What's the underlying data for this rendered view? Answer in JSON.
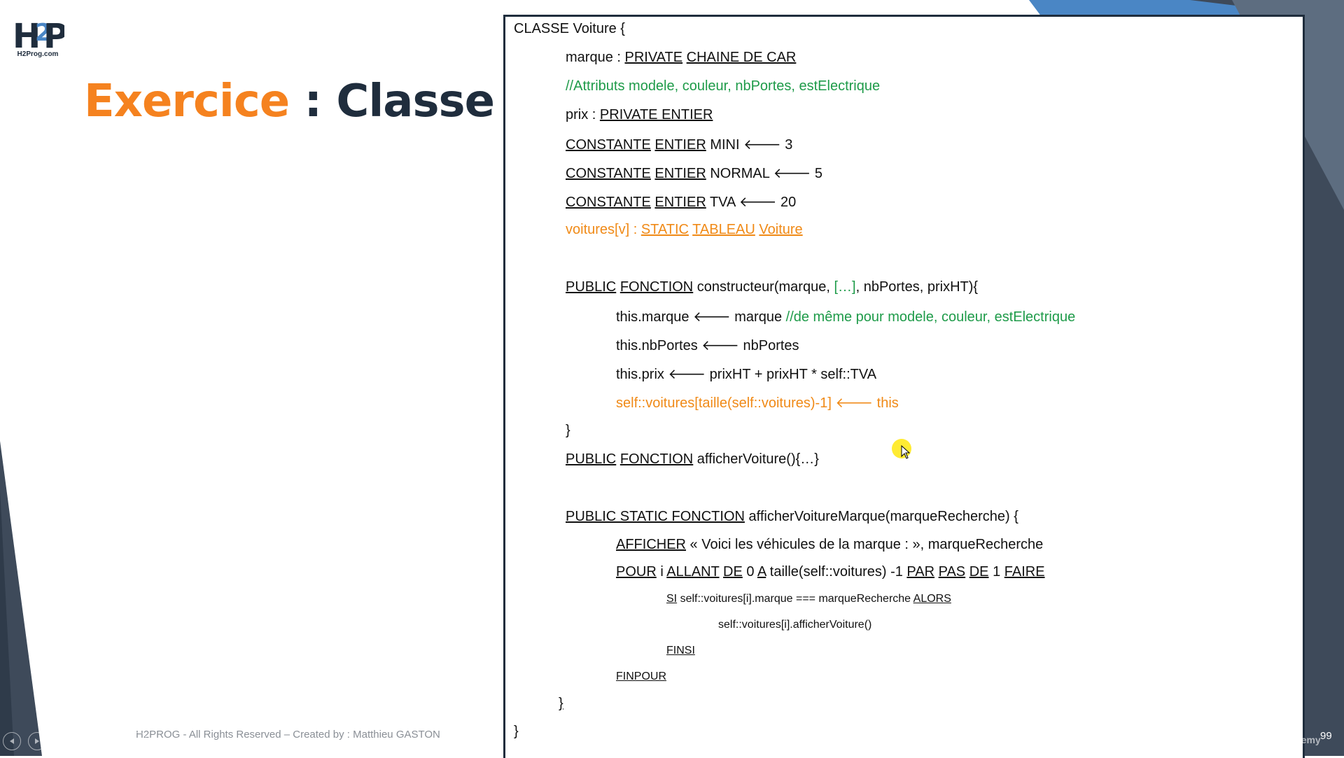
{
  "logo": {
    "caption": "H2Prog.com"
  },
  "slide": {
    "title_orange": "Exercice",
    "title_rest": " : Classe"
  },
  "code": {
    "l1": "CLASSE Voiture {",
    "l2_a": "marque : ",
    "l2_b": "PRIVATE",
    "l2_c": " ",
    "l2_d": "CHAINE DE CAR",
    "l3": "//Attributs modele, couleur, nbPortes, estElectrique",
    "l4_a": "prix : ",
    "l4_b": "PRIVATE ENTIER",
    "l5_a": "CONSTANTE",
    "l5_b": "ENTIER",
    "l5_c": " MINI ",
    "l5_d": " 3",
    "l6_a": "CONSTANTE",
    "l6_b": "ENTIER",
    "l6_c": " NORMAL ",
    "l6_d": " 5",
    "l7_a": "CONSTANTE",
    "l7_b": "ENTIER",
    "l7_c": " TVA ",
    "l7_d": " 20",
    "l8_a": "voitures[v] : ",
    "l8_b": "STATIC",
    "l8_c": "TABLEAU",
    "l8_d": "Voiture",
    "l9_a": "PUBLIC",
    "l9_b": "FONCTION",
    "l9_c": " constructeur(marque, ",
    "l9_d": "[…]",
    "l9_e": ", nbPortes, prixHT){",
    "l10_a": "this.marque ",
    "l10_b": " marque ",
    "l10_c": "//de même pour modele, couleur, estElectrique",
    "l11_a": "this.nbPortes ",
    "l11_b": " nbPortes",
    "l12_a": "this.prix ",
    "l12_b": " prixHT + prixHT * self::TVA",
    "l13_a": "self::voitures[taille(self::voitures)-1] ",
    "l13_b": " this",
    "l14": "}",
    "l15_a": "PUBLIC",
    "l15_b": "FONCTION",
    "l15_c": " afficherVoiture(){…}",
    "l16_a": "PUBLIC STATIC FONCTION",
    "l16_b": " afficherVoitureMarque(marqueRecherche) {",
    "l17_a": "AFFICHER",
    "l17_b": " « Voici les véhicules de la marque :  », marqueRecherche",
    "l18_a": "POUR",
    "l18_b": " i ",
    "l18_c": "ALLANT",
    "l18_d": " ",
    "l18_e": "DE",
    "l18_f": " 0 ",
    "l18_g": "A",
    "l18_h": " taille(self::voitures) -1 ",
    "l18_i": "PAR",
    "l18_j": " ",
    "l18_k": "PAS",
    "l18_l": " ",
    "l18_m": "DE",
    "l18_n": " 1 ",
    "l18_o": "FAIRE",
    "l19_a": "SI",
    "l19_b": " self::voitures[i].marque === marqueRecherche ",
    "l19_c": "ALORS",
    "l20": "self::voitures[i].afficherVoiture()",
    "l21": "FINSI",
    "l22": "FINPOUR",
    "l23": "}",
    "l24": "}"
  },
  "footer": {
    "text": "H2PROG - All Rights Reserved – Created by : Matthieu GASTON",
    "page_number": "99",
    "watermark": "Udemy"
  },
  "icons": {
    "nav": [
      "previous-slide-icon",
      "next-slide-icon",
      "pen-icon",
      "slides-icon",
      "zoom-icon",
      "more-icon"
    ]
  },
  "colors": {
    "orange": "#f5821f",
    "dark_navy": "#1f2d3d",
    "comment_green": "#1e9b49",
    "code_orange": "#f08a17",
    "accent_blue": "#4a86c5"
  }
}
